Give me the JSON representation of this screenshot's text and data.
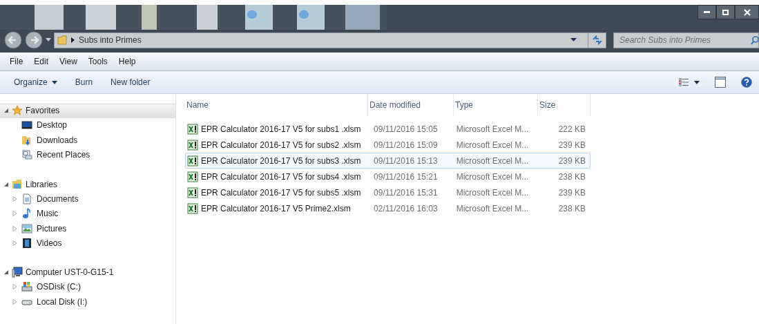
{
  "address_bar": {
    "path": [
      "Subs into Primes"
    ]
  },
  "search": {
    "placeholder": "Search Subs into Primes"
  },
  "menu_bar": [
    "File",
    "Edit",
    "View",
    "Tools",
    "Help"
  ],
  "toolbar": [
    {
      "label": "Organize",
      "dropdown": true
    },
    {
      "label": "Burn",
      "dropdown": false
    },
    {
      "label": "New folder",
      "dropdown": false
    }
  ],
  "sidebar": [
    {
      "label": "Favorites",
      "expanded": true,
      "hovered": true,
      "children": [
        {
          "label": "Desktop"
        },
        {
          "label": "Downloads"
        },
        {
          "label": "Recent Places"
        }
      ]
    },
    {
      "label": "Libraries",
      "expanded": true,
      "hovered": false,
      "children": [
        {
          "label": "Documents",
          "expanded": false
        },
        {
          "label": "Music",
          "expanded": false
        },
        {
          "label": "Pictures",
          "expanded": false
        },
        {
          "label": "Videos",
          "expanded": false
        }
      ]
    },
    {
      "label": "Computer UST-0-G15-1",
      "expanded": true,
      "hovered": false,
      "children": [
        {
          "label": "OSDisk (C:)",
          "expanded": false
        },
        {
          "label": "Local Disk (I:)",
          "expanded": false
        }
      ]
    }
  ],
  "table": {
    "columns": [
      "Name",
      "Date modified",
      "Type",
      "Size"
    ],
    "rows": [
      {
        "name": "EPR Calculator 2016-17 V5 for subs1 .xlsm",
        "date": "09/11/2016 15:05",
        "type": "Microsoft Excel M...",
        "size": "222 KB",
        "hovered": false
      },
      {
        "name": "EPR Calculator 2016-17 V5 for subs2 .xlsm",
        "date": "09/11/2016 15:09",
        "type": "Microsoft Excel M...",
        "size": "239 KB",
        "hovered": false
      },
      {
        "name": "EPR Calculator 2016-17 V5 for subs3 .xlsm",
        "date": "09/11/2016 15:13",
        "type": "Microsoft Excel M...",
        "size": "239 KB",
        "hovered": true
      },
      {
        "name": "EPR Calculator 2016-17 V5 for subs4 .xlsm",
        "date": "09/11/2016 15:21",
        "type": "Microsoft Excel M...",
        "size": "238 KB",
        "hovered": false
      },
      {
        "name": "EPR Calculator 2016-17 V5 for subs5 .xlsm",
        "date": "09/11/2016 15:31",
        "type": "Microsoft Excel M...",
        "size": "239 KB",
        "hovered": false
      },
      {
        "name": "EPR Calculator 2016-17 V5 Prime2.xlsm",
        "date": "02/11/2016 16:03",
        "type": "Microsoft Excel M...",
        "size": "238 KB",
        "hovered": false
      }
    ]
  }
}
